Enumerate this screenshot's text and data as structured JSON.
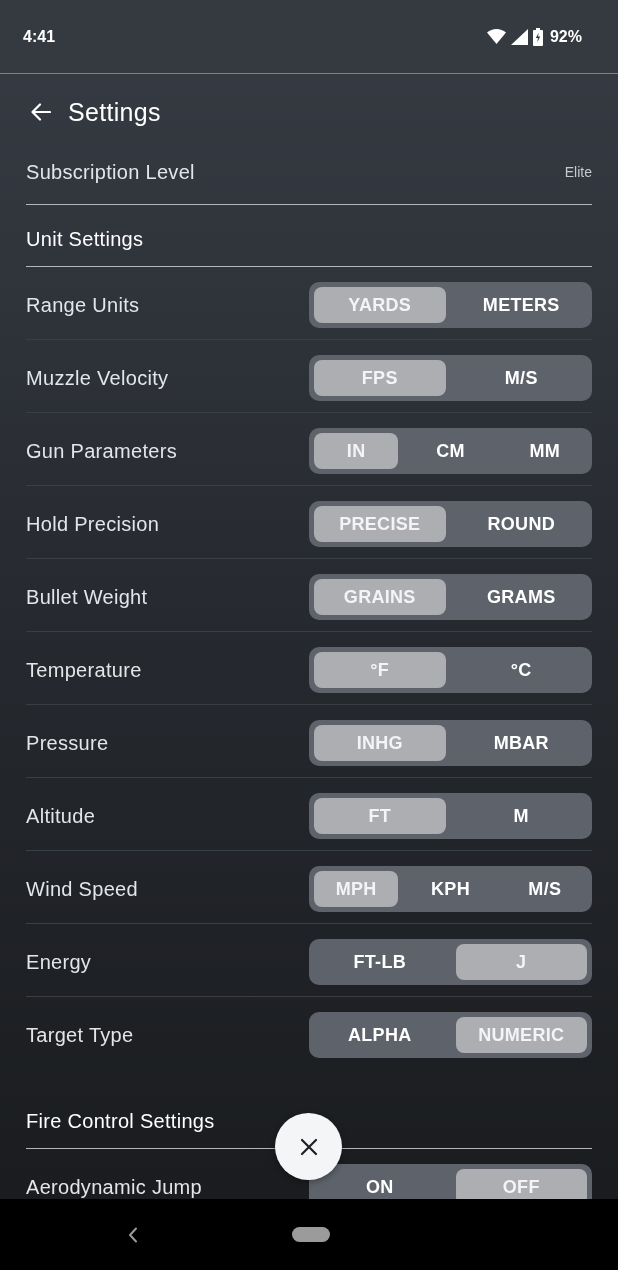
{
  "status_bar": {
    "time": "4:41",
    "battery": "92%"
  },
  "header": {
    "title": "Settings"
  },
  "subscription": {
    "label": "Subscription Level",
    "value": "Elite"
  },
  "sections": [
    {
      "title": "Unit Settings",
      "rows": [
        {
          "label": "Range Units",
          "options": [
            {
              "label": "YARDS",
              "selected": true
            },
            {
              "label": "METERS",
              "selected": false
            }
          ]
        },
        {
          "label": "Muzzle Velocity",
          "options": [
            {
              "label": "FPS",
              "selected": true
            },
            {
              "label": "M/S",
              "selected": false
            }
          ]
        },
        {
          "label": "Gun Parameters",
          "options": [
            {
              "label": "IN",
              "selected": true
            },
            {
              "label": "CM",
              "selected": false
            },
            {
              "label": "MM",
              "selected": false
            }
          ]
        },
        {
          "label": "Hold Precision",
          "options": [
            {
              "label": "PRECISE",
              "selected": true
            },
            {
              "label": "ROUND",
              "selected": false
            }
          ]
        },
        {
          "label": "Bullet Weight",
          "options": [
            {
              "label": "GRAINS",
              "selected": true
            },
            {
              "label": "GRAMS",
              "selected": false
            }
          ]
        },
        {
          "label": "Temperature",
          "options": [
            {
              "label": "°F",
              "selected": true
            },
            {
              "label": "°C",
              "selected": false
            }
          ]
        },
        {
          "label": "Pressure",
          "options": [
            {
              "label": "INHG",
              "selected": true
            },
            {
              "label": "MBAR",
              "selected": false
            }
          ]
        },
        {
          "label": "Altitude",
          "options": [
            {
              "label": "FT",
              "selected": true
            },
            {
              "label": "M",
              "selected": false
            }
          ]
        },
        {
          "label": "Wind Speed",
          "options": [
            {
              "label": "MPH",
              "selected": true
            },
            {
              "label": "KPH",
              "selected": false
            },
            {
              "label": "M/S",
              "selected": false
            }
          ]
        },
        {
          "label": "Energy",
          "options": [
            {
              "label": "FT-LB",
              "selected": false
            },
            {
              "label": "J",
              "selected": true
            }
          ]
        },
        {
          "label": "Target Type",
          "options": [
            {
              "label": "ALPHA",
              "selected": false
            },
            {
              "label": "NUMERIC",
              "selected": true
            }
          ]
        }
      ]
    },
    {
      "title": "Fire Control Settings",
      "rows": [
        {
          "label": "Aerodynamic Jump",
          "options": [
            {
              "label": "ON",
              "selected": false
            },
            {
              "label": "OFF",
              "selected": true
            }
          ]
        }
      ]
    }
  ]
}
